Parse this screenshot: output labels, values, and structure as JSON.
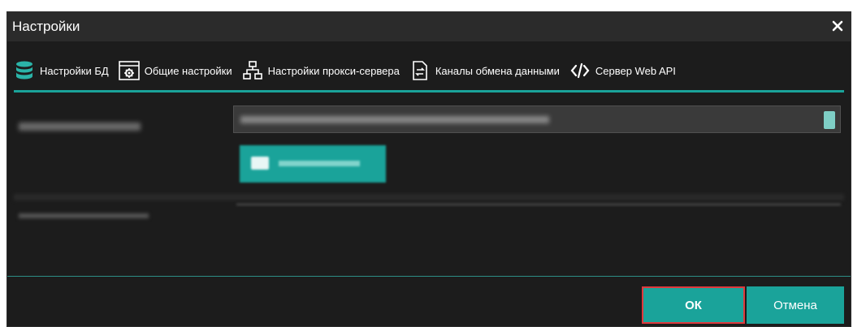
{
  "window": {
    "title": "Настройки"
  },
  "tabs": [
    {
      "label": "Настройки БД",
      "icon": "database-icon",
      "active": true
    },
    {
      "label": "Общие настройки",
      "icon": "settings-window-icon",
      "active": false
    },
    {
      "label": "Настройки прокси-сервера",
      "icon": "network-icon",
      "active": false
    },
    {
      "label": "Каналы обмена данными",
      "icon": "exchange-document-icon",
      "active": false
    },
    {
      "label": "Сервер Web API",
      "icon": "code-icon",
      "active": false
    }
  ],
  "footer": {
    "ok_label": "ОК",
    "cancel_label": "Отмена"
  },
  "colors": {
    "accent": "#1aa39a",
    "background": "#1c1c1c",
    "titlebar": "#2b2b2b",
    "highlight_border": "#e0393d"
  }
}
